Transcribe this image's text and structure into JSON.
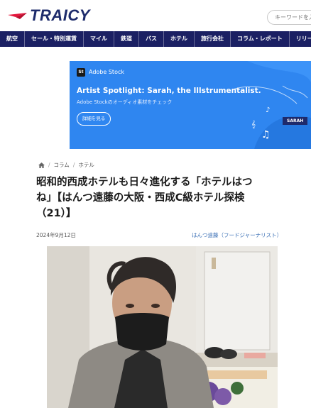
{
  "header": {
    "logo_text": "TRAICY",
    "search_placeholder": "キーワードを入"
  },
  "nav": {
    "items": [
      "航空",
      "セール・特別運賃",
      "マイル",
      "鉄道",
      "バス",
      "ホテル",
      "旅行会社",
      "コラム・レポート",
      "リリース"
    ]
  },
  "ad": {
    "badge": "St",
    "brand": "Adobe Stock",
    "title": "Artist Spotlight: Sarah, the Illstrumentalist.",
    "subtitle": "Adobe Stockのオーディオ素材をチェック",
    "button": "詳細を見る",
    "tag": "SARAH",
    "colors": {
      "background": "#2f86f0",
      "tag": "#1e2a6b"
    }
  },
  "breadcrumb": {
    "items": [
      "コラム",
      "ホテル"
    ]
  },
  "article": {
    "title_lines": [
      "昭和的西成ホテルも日々進化する「ホテルはつ",
      "ね」【はんつ遠藤の大阪・西成C級ホテル探検",
      "（21）】"
    ],
    "date": "2024年9月12日",
    "author": "はんつ遠藤（フードジャーナリスト）"
  },
  "colors": {
    "nav": "#1b2063",
    "logo": "#1d2b6b",
    "logo_mark": "#e4153b",
    "author_link": "#3a6fb5"
  }
}
